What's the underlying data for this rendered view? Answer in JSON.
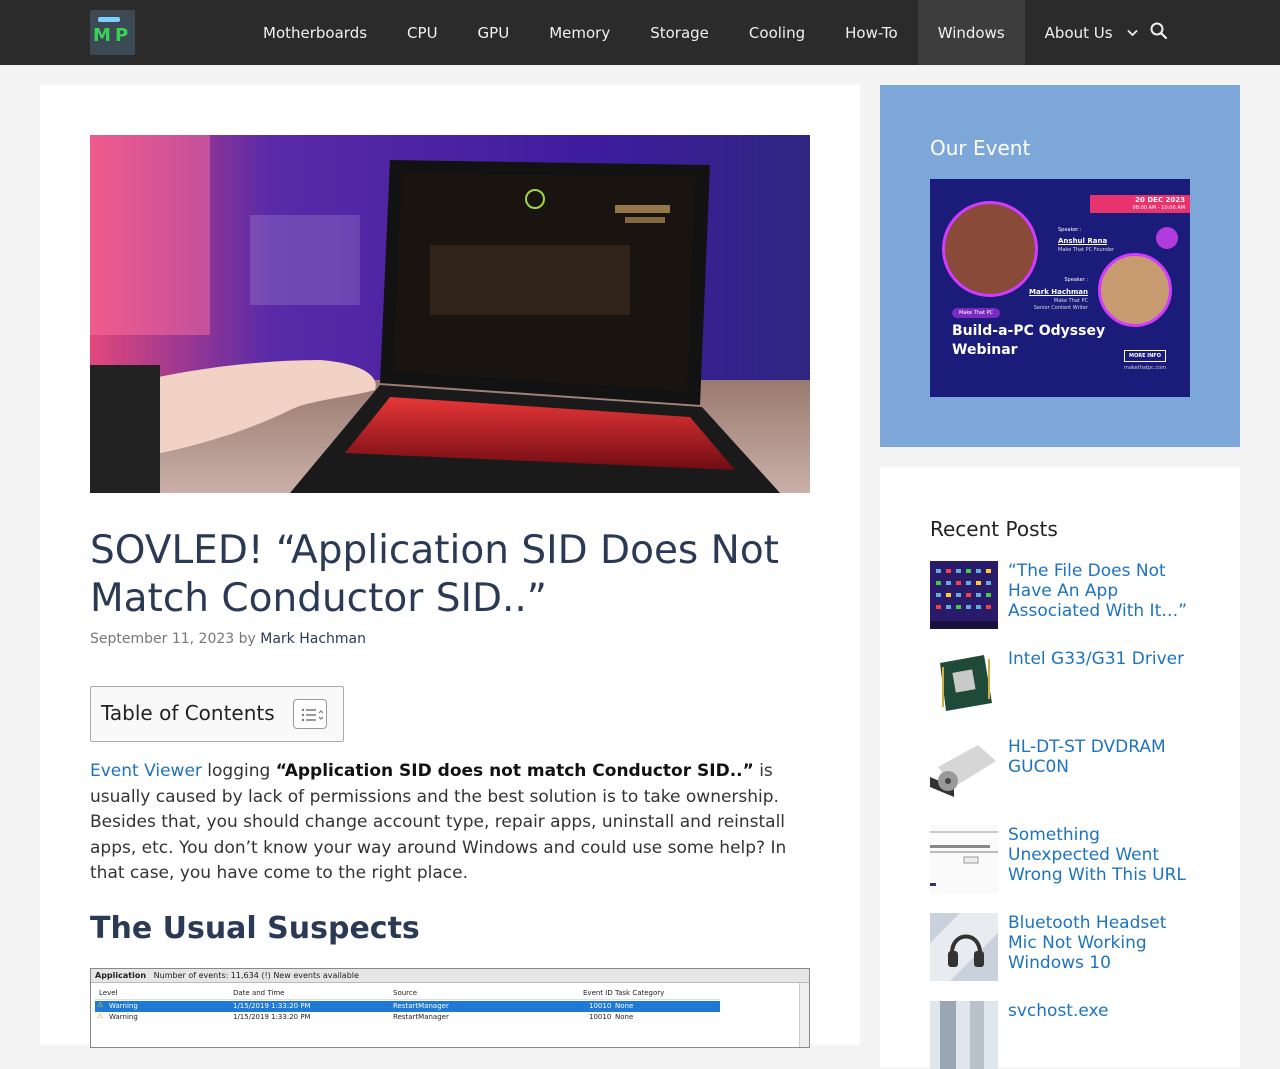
{
  "header": {
    "logo_text_m": "M",
    "logo_text_p": "P",
    "nav": [
      {
        "label": "Motherboards"
      },
      {
        "label": "CPU"
      },
      {
        "label": "GPU"
      },
      {
        "label": "Memory"
      },
      {
        "label": "Storage"
      },
      {
        "label": "Cooling"
      },
      {
        "label": "How-To"
      },
      {
        "label": "Windows",
        "active": true
      },
      {
        "label": "About Us",
        "has_dropdown": true
      }
    ]
  },
  "article": {
    "title": "SOVLED! “Application SID Does Not Match Conductor SID..”",
    "date": "September 11, 2023",
    "by": "by",
    "author": "Mark Hachman",
    "toc_title": "Table of Contents",
    "intro": {
      "link": "Event Viewer",
      "text1": " logging  ",
      "bold": "“Application SID does not match Conductor SID..”",
      "text2": " is usually caused by lack of permissions and the best solution is to take ownership. Besides that, you should change account type, repair apps, uninstall and reinstall apps, etc. You don’t know your way around Windows and could use some help? In that case, you have come to the right place."
    },
    "h2": "The Usual Suspects",
    "screenshot": {
      "tab": "Application",
      "summary": "Number of events: 11,634 (!) New events available",
      "columns": [
        "Level",
        "Date and Time",
        "Source",
        "Event ID",
        "Task Category"
      ],
      "rows": [
        [
          "Warning",
          "1/15/2019 1:33:20 PM",
          "RestartManager",
          "10010",
          "None"
        ],
        [
          "Warning",
          "1/15/2019 1:33:20 PM",
          "RestartManager",
          "10010",
          "None"
        ]
      ]
    }
  },
  "sidebar": {
    "event_title": "Our Event",
    "banner": {
      "date": "20 DEC 2023",
      "time": "08:00 AM - 10:00 AM",
      "speaker_label": "Speaker :",
      "speaker1_name": "Anshul Rana",
      "speaker1_role": "Make That PC Founder",
      "speaker2_name": "Mark Hachman",
      "speaker2_role1": "Make That PC",
      "speaker2_role2": "Senior Content Writer",
      "brand_small": "Make That PC",
      "headline1": "Build-a-PC Odyssey",
      "headline2": "Webinar",
      "more_info": "MORE INFO",
      "site": "makethatpc.com"
    },
    "recent_title": "Recent Posts",
    "recent_posts": [
      {
        "title": "“The File Does Not Have An App Associated With It…”"
      },
      {
        "title": "Intel G33/G31 Driver"
      },
      {
        "title": "HL-DT-ST DVDRAM GUC0N"
      },
      {
        "title": "Something Unexpected Went Wrong With This URL"
      },
      {
        "title": "Bluetooth Headset Mic Not Working Windows 10"
      },
      {
        "title": "svchost.exe"
      }
    ]
  },
  "colors": {
    "header_bg": "#2b2b2b",
    "link": "#1e73be",
    "title": "#2a3a55",
    "event_panel": "#7ea7d9"
  }
}
